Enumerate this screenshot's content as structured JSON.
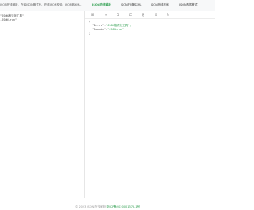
{
  "topbar": {
    "left_text": "JSON在线解析、在线JSON格式化、在线JSON校验、JSON转XML、JS..."
  },
  "tabs": [
    {
      "label": "JSON在线解析",
      "active": true
    },
    {
      "label": "JSON在线转XML",
      "active": false
    },
    {
      "label": "JSON在线压缩",
      "active": false
    },
    {
      "label": "JSON数据格式",
      "active": false
    }
  ],
  "left_editor": {
    "lines": [
      "\"JSON格式化工具\",",
      ".JSON.run\""
    ]
  },
  "toolbar": {
    "icons": [
      {
        "name": "format-icon",
        "glyph": "⊞"
      },
      {
        "name": "compress-icon",
        "glyph": "≡"
      },
      {
        "name": "expand-icon",
        "glyph": "⊐"
      },
      {
        "name": "collapse-icon",
        "glyph": "⊏"
      },
      {
        "name": "copy-icon",
        "glyph": "⎘"
      },
      {
        "name": "clear-icon",
        "glyph": "⊡"
      },
      {
        "name": "edit-icon",
        "glyph": "✎"
      }
    ]
  },
  "output": {
    "open": "{",
    "lines": [
      {
        "key": "\"Intro\"",
        "value": "\"JSON格式化工具\","
      },
      {
        "key": "\"Domain\"",
        "value": "\"JSON.run\""
      }
    ],
    "close": "}"
  },
  "footer": {
    "text": "© 2023  JSON 在线解析  ",
    "brand": "浙ICP备2020001375-1号"
  },
  "colors": {
    "accent": "#2e9e4f",
    "topbar_bg": "#f7f8f9"
  }
}
